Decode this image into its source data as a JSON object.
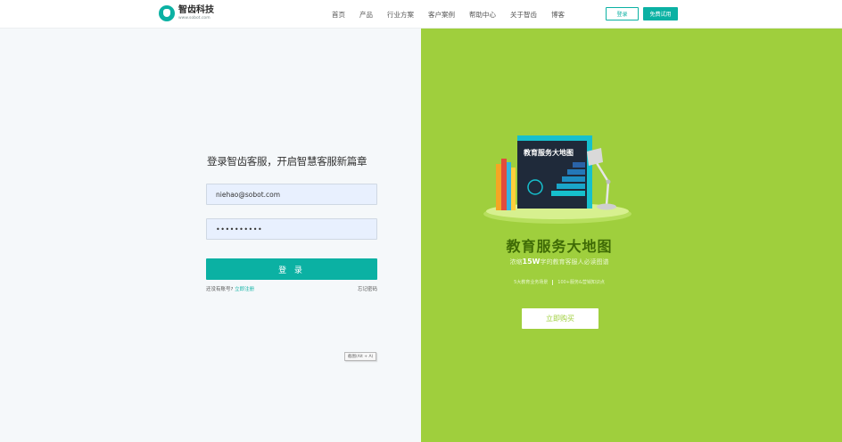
{
  "header": {
    "logo_name": "智齿科技",
    "logo_url": "www.sobot.com",
    "nav": [
      "首页",
      "产品",
      "行业方案",
      "客户案例",
      "帮助中心",
      "关于智齿",
      "博客"
    ],
    "login_label": "登录",
    "trial_label": "免费试用"
  },
  "login": {
    "title": "登录智齿客服，开启智慧客服新篇章",
    "email_value": "niehao@sobot.com",
    "password_masked": "••••••••••",
    "submit_label": "登 录",
    "no_account_text": "还没有账号?",
    "register_link": "立即注册",
    "forgot_link": "忘记密码",
    "screenshot_tip": "截图(Alt + A)"
  },
  "promo": {
    "book_title": "教育服务大地图",
    "title": "教育服务大地图",
    "subtitle_prefix": "浓缩",
    "subtitle_highlight": "15W",
    "subtitle_suffix": "字的教育客服人必读图谱",
    "stat_1": "5大教育业务场景",
    "stat_2": "100+服务&营销知识点",
    "buy_label": "立即购买"
  },
  "colors": {
    "brand": "#0bb1a3",
    "promo_bg": "#9fcf3d",
    "promo_title": "#3f6b06"
  }
}
